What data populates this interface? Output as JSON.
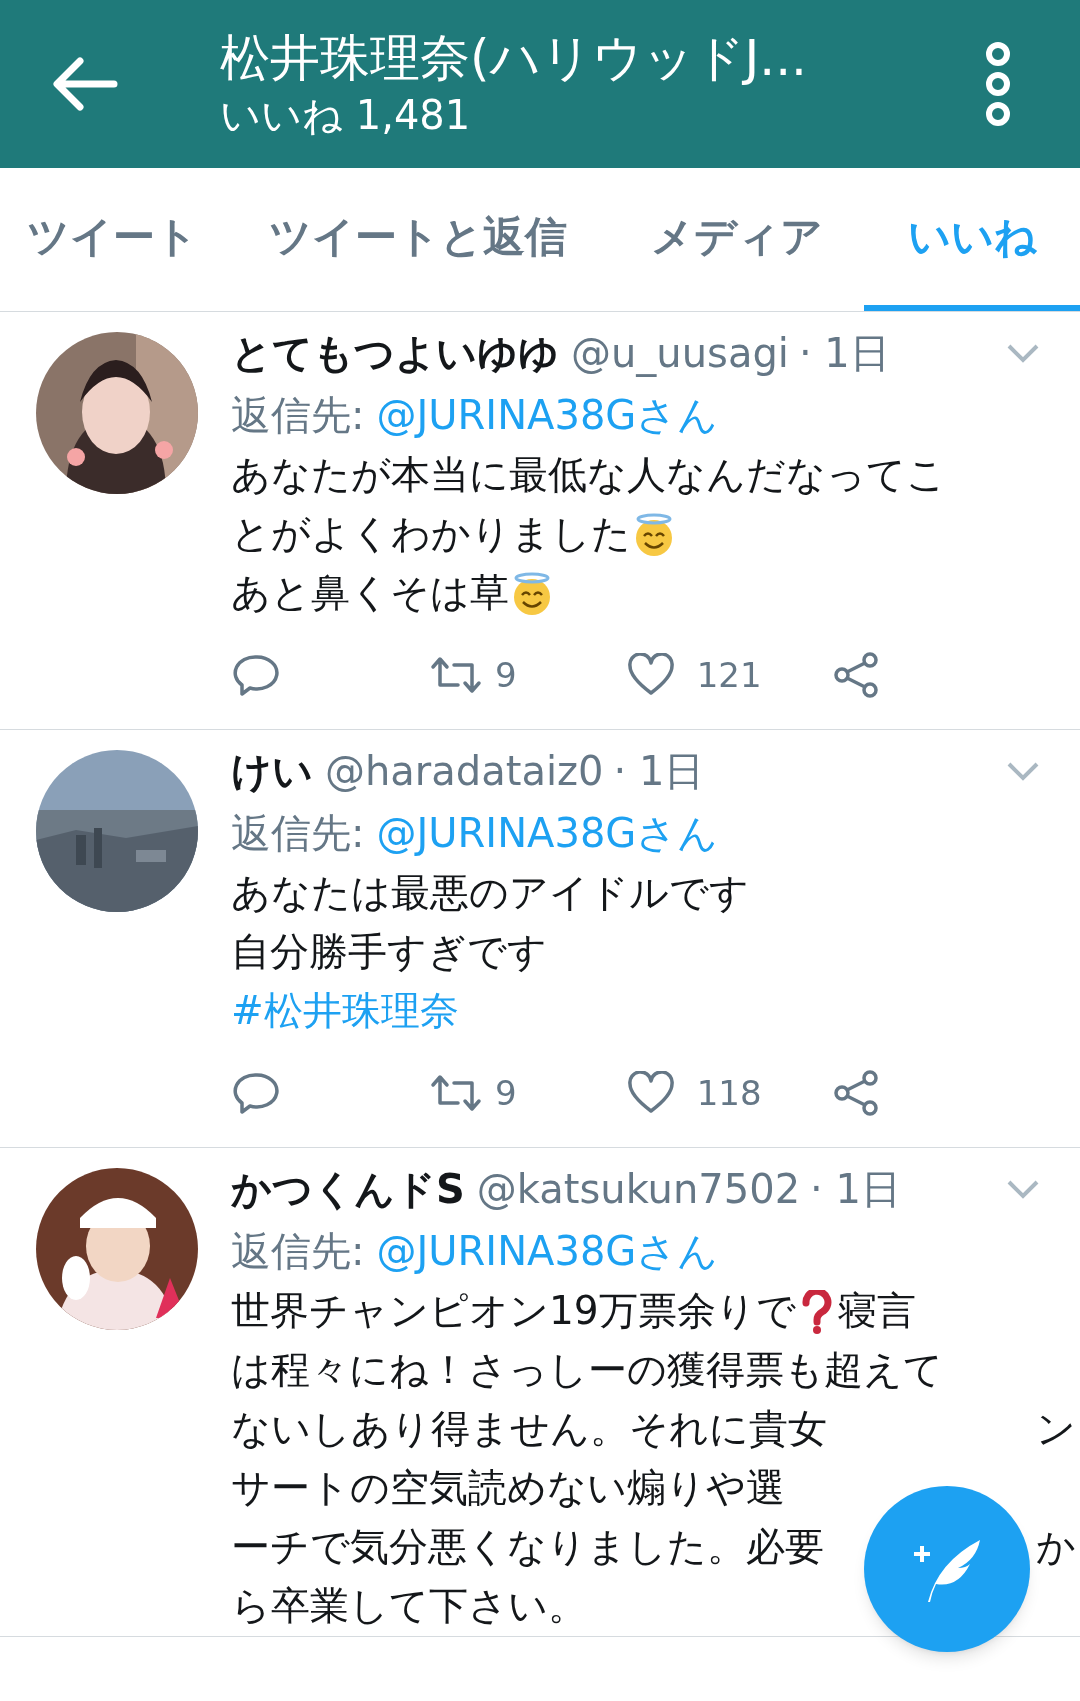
{
  "header": {
    "title": "松井珠理奈(ハリウッドJ...",
    "subtitle": "いいね 1,481"
  },
  "tabs": [
    {
      "label": "ツイート",
      "selected": false
    },
    {
      "label": "ツイートと返信",
      "selected": false
    },
    {
      "label": "メディア",
      "selected": false
    },
    {
      "label": "いいね",
      "selected": true
    }
  ],
  "tweets": [
    {
      "name": "とてもつよいゆゆ",
      "handle": "@u_uusagi",
      "time": "· 1日",
      "reply_label": "返信先:",
      "reply_to": "@JURINA38Gさん",
      "body": [
        [
          {
            "kind": "text",
            "text": "あなたが本当に最低な人なんだなってこ"
          }
        ],
        [
          {
            "kind": "text",
            "text": "とがよくわかりました"
          },
          {
            "kind": "halo-emoji"
          }
        ],
        [
          {
            "kind": "text",
            "text": "あと鼻くそは草"
          },
          {
            "kind": "halo-emoji"
          }
        ]
      ],
      "retweets": "9",
      "likes": "121"
    },
    {
      "name": "けい",
      "handle": "@haradataiz0",
      "time": "· 1日",
      "reply_label": "返信先:",
      "reply_to": "@JURINA38Gさん",
      "body": [
        [
          {
            "kind": "text",
            "text": "あなたは最悪のアイドルです"
          }
        ],
        [
          {
            "kind": "text",
            "text": "自分勝手すぎです"
          }
        ],
        [
          {
            "kind": "hashtag",
            "text": "#松井珠理奈"
          }
        ]
      ],
      "retweets": "9",
      "likes": "118"
    },
    {
      "name": "かつくんドS",
      "handle": "@katsukun7502",
      "time": "· 1日",
      "reply_label": "返信先:",
      "reply_to": "@JURINA38Gさん",
      "body": [
        [
          {
            "kind": "text",
            "text": "世界チャンピオン19万票余りで"
          },
          {
            "kind": "question-emoji"
          },
          {
            "kind": "text",
            "text": "寝言"
          }
        ],
        [
          {
            "kind": "text",
            "text": "は程々にね！さっしーの獲得票も超えて"
          }
        ],
        [
          {
            "kind": "text",
            "text": "ないしあり得ません。それに貴女"
          },
          {
            "kind": "after",
            "text": "ン"
          }
        ],
        [
          {
            "kind": "text",
            "text": "サートの空気読めない煽りや選"
          }
        ],
        [
          {
            "kind": "text",
            "text": "ーチで気分悪くなりました。必要"
          },
          {
            "kind": "after",
            "text": "か"
          }
        ],
        [
          {
            "kind": "text",
            "text": "ら卒業して下さい。"
          }
        ]
      ]
    }
  ]
}
